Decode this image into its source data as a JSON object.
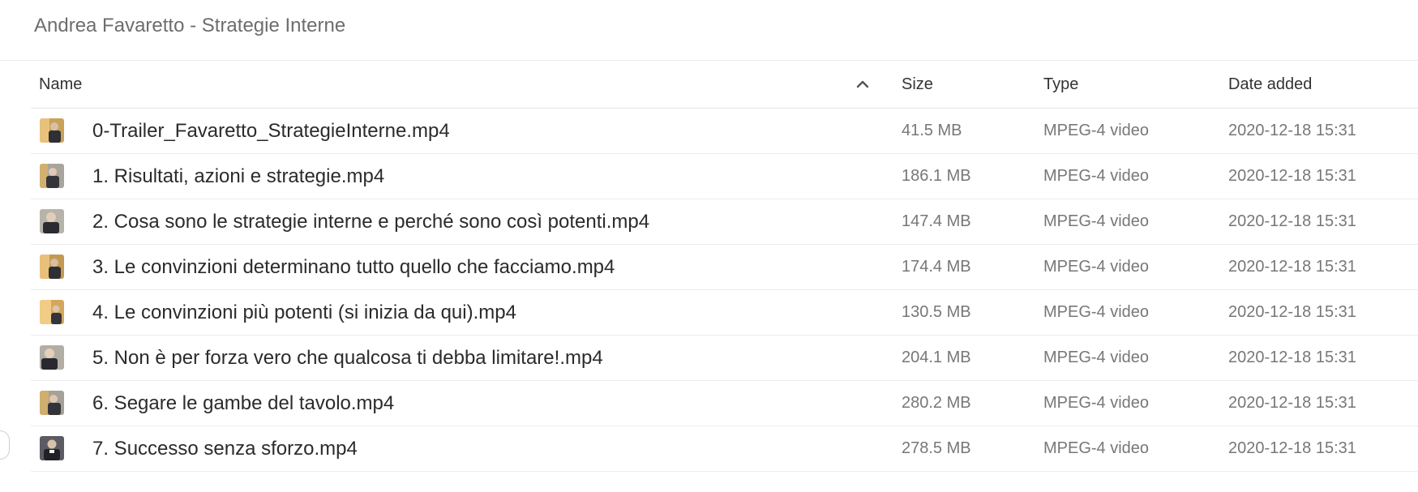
{
  "header": {
    "folder_title": "Andrea Favaretto - Strategie Interne"
  },
  "columns": {
    "name": "Name",
    "size": "Size",
    "type": "Type",
    "date": "Date added"
  },
  "sort_icon": "chevron-up-icon",
  "thumbnail_icon": "video-thumbnail",
  "files": [
    {
      "name": "0-Trailer_Favaretto_StrategieInterne.mp4",
      "size": "41.5 MB",
      "type": "MPEG-4 video",
      "date": "2020-12-18 15:31"
    },
    {
      "name": "1. Risultati, azioni e strategie.mp4",
      "size": "186.1 MB",
      "type": "MPEG-4 video",
      "date": "2020-12-18 15:31"
    },
    {
      "name": "2. Cosa sono le strategie interne e perché sono così potenti.mp4",
      "size": "147.4 MB",
      "type": "MPEG-4 video",
      "date": "2020-12-18 15:31"
    },
    {
      "name": "3. Le convinzioni determinano tutto quello che facciamo.mp4",
      "size": "174.4 MB",
      "type": "MPEG-4 video",
      "date": "2020-12-18 15:31"
    },
    {
      "name": "4. Le convinzioni più potenti (si inizia da qui).mp4",
      "size": "130.5 MB",
      "type": "MPEG-4 video",
      "date": "2020-12-18 15:31"
    },
    {
      "name": "5. Non è per forza vero che qualcosa ti debba limitare!.mp4",
      "size": "204.1 MB",
      "type": "MPEG-4 video",
      "date": "2020-12-18 15:31"
    },
    {
      "name": "6. Segare le gambe del tavolo.mp4",
      "size": "280.2 MB",
      "type": "MPEG-4 video",
      "date": "2020-12-18 15:31"
    },
    {
      "name": "7. Successo senza sforzo.mp4",
      "size": "278.5 MB",
      "type": "MPEG-4 video",
      "date": "2020-12-18 15:31"
    }
  ]
}
